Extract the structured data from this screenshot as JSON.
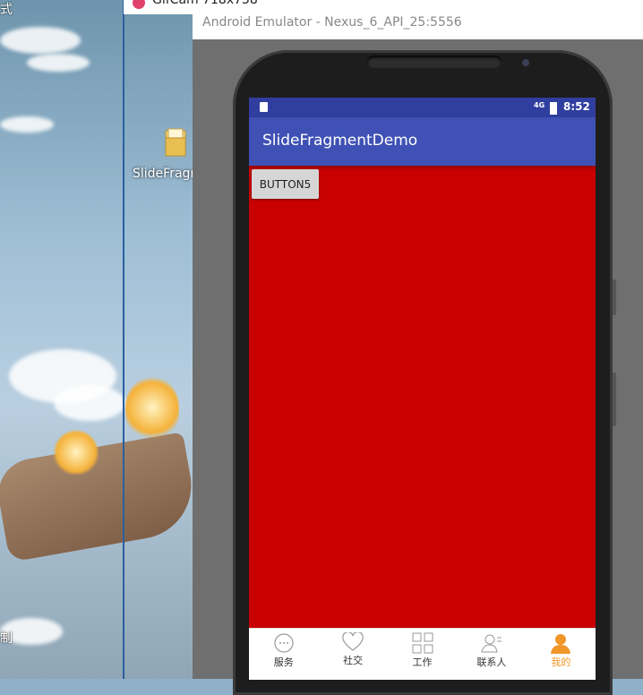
{
  "desktop": {
    "corner_text": "式",
    "corner_text2": "制",
    "folder_label": "SlideFragmentDemo"
  },
  "gifcam": {
    "title": "GifCam 718x758"
  },
  "emulator": {
    "title": "Android Emulator - Nexus_6_API_25:5556"
  },
  "status_bar": {
    "network": "4G",
    "time": "8:52"
  },
  "app": {
    "title": "SlideFragmentDemo",
    "button_label": "BUTTON5",
    "background_color": "#c80000",
    "primary_color": "#3f51b5",
    "primary_dark_color": "#303f9f"
  },
  "tabs": [
    {
      "label": "服务",
      "icon": "chat-bubble-icon",
      "active": false
    },
    {
      "label": "社交",
      "icon": "heart-icon",
      "active": false
    },
    {
      "label": "工作",
      "icon": "grid-icon",
      "active": false
    },
    {
      "label": "联系人",
      "icon": "contacts-icon",
      "active": false
    },
    {
      "label": "我的",
      "icon": "person-icon",
      "active": true
    }
  ],
  "accent_color": "#f0962a"
}
